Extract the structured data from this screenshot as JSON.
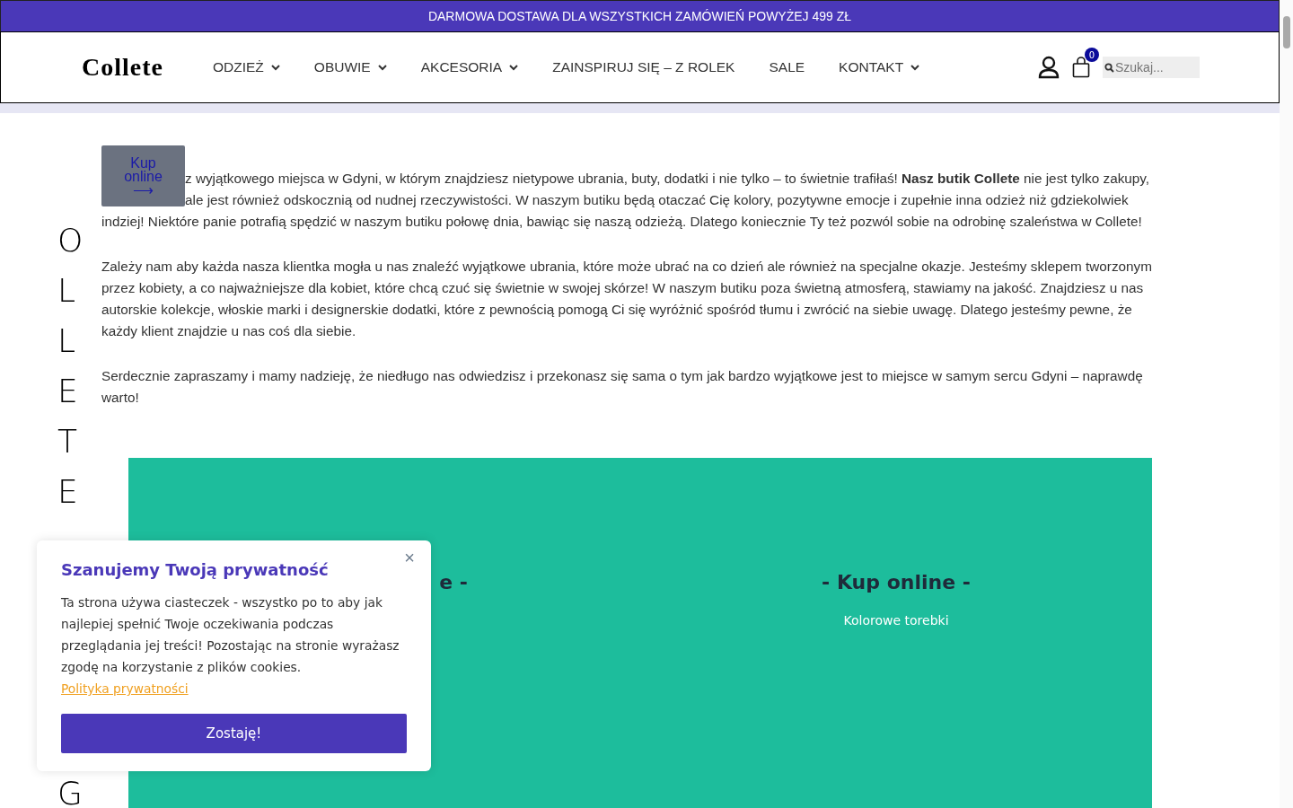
{
  "top_banner": {
    "text": "DARMOWA DOSTAWA DLA WSZYSTKICH ZAMÓWIEŃ POWYŻEJ 499 ZŁ"
  },
  "header": {
    "logo": "Collete",
    "nav": [
      {
        "label": "ODZIEŻ",
        "has_dropdown": true
      },
      {
        "label": "OBUWIE",
        "has_dropdown": true
      },
      {
        "label": "AKCESORIA",
        "has_dropdown": true
      },
      {
        "label": "ZAINSPIRUJ SIĘ – Z ROLEK",
        "has_dropdown": false
      },
      {
        "label": "SALE",
        "has_dropdown": false
      },
      {
        "label": "KONTAKT",
        "has_dropdown": true
      }
    ],
    "cart_count": "0",
    "search": {
      "placeholder": "Szukaj..."
    }
  },
  "shop_button": {
    "label": "Kup online",
    "arrow": "⟶"
  },
  "paragraphs": [
    "z wyjątkowego miejsca w Gdyni, w którym znajdziesz nietypowe ubrania, buty, dodatki i nie tylko – to świetnie trafiłaś! **Nasz butik Collete** nie jest tylko zakupy, ale jest również odskocznią od nudnej rzeczywistości. W naszym butiku będą otaczać Cię kolory, pozytywne emocje i zupełnie inna odzież niż gdziekolwiek indziej! Niektóre panie potrafią spędzić w naszym butiku połowę dnia, bawiąc się naszą odzieżą. Dlatego koniecznie Ty też pozwól sobie na odrobinę szaleństwa w Collete!",
    "Zależy nam aby każda nasza klientka mogła u nas znaleźć wyjątkowe ubrania, które może ubrać na co dzień ale również na specjalne okazje. Jesteśmy sklepem tworzonym przez kobiety, a co najważniejsze dla kobiet, które chcą czuć się świetnie w swojej skórze! W naszym butiku poza świetną atmosferą, stawiamy na jakość. Znajdziesz u nas autorskie kolekcje, włoskie marki i designerskie dodatki, które z pewnością pomogą Ci się wyróżnić spośród tłumu i zwrócić na siebie uwagę. Dlatego jesteśmy pewne, że każdy klient znajdzie u nas coś dla siebie.",
    "Serdecznie zapraszamy i mamy nadzieję, że niedługo nas odwiedzisz i przekonasz się sama o tym jak bardzo wyjątkowe jest to miejsce w samym sercu Gdyni – naprawdę warto!"
  ],
  "vertical_letters_top": [
    "O",
    "L",
    "L",
    "E",
    "T",
    "E"
  ],
  "vertical_letters_bottom": [
    "G"
  ],
  "promo_cards": [
    {
      "title": "e -"
    },
    {
      "title": "- Kup online -",
      "subtitle": "Kolorowe torebki"
    }
  ],
  "cookie_popup": {
    "title": "Szanujemy Twoją prywatność",
    "text": "Ta strona używa ciasteczek - wszystko po to aby jak najlepiej spełnić Twoje oczekiwania podczas przeglądania jej treści! Pozostając na stronie wyrażasz zgodę na korzystanie z plików cookies.",
    "link": "Polityka prywatności",
    "button": "Zostaję!",
    "close": "×"
  }
}
